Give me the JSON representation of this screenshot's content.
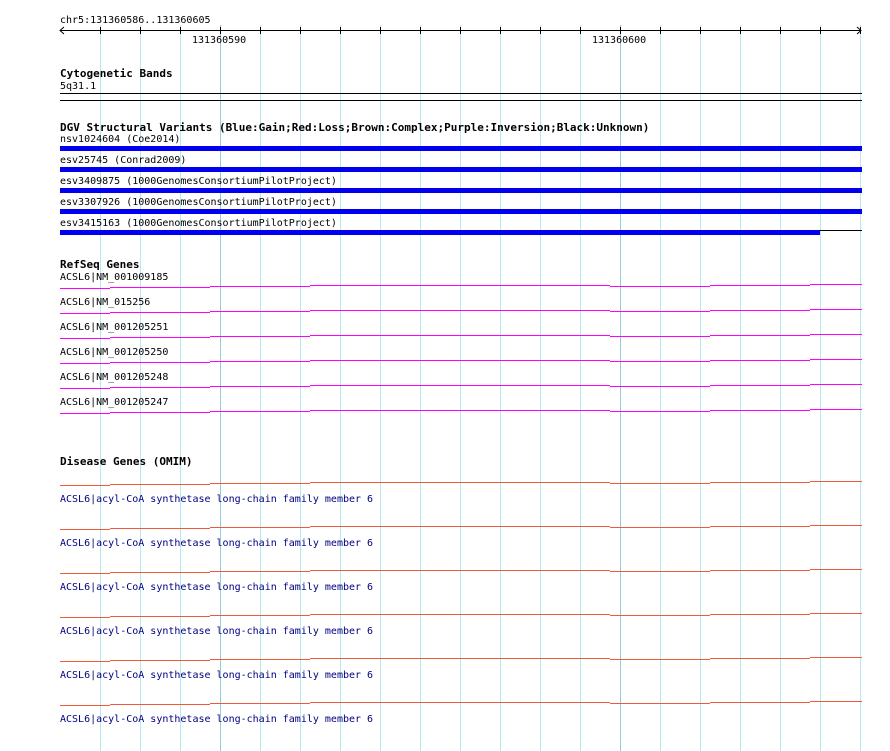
{
  "ruler": {
    "location": "chr5:131360586..131360605",
    "tick_labels": [
      "131360590",
      "131360600"
    ]
  },
  "cytoband": {
    "title": "Cytogenetic Bands",
    "band": "5q31.1"
  },
  "dgv": {
    "title": "DGV Structural Variants (Blue:Gain;Red:Loss;Brown:Complex;Purple:Inversion;Black:Unknown)",
    "items": [
      "nsv1024604 (Coe2014)",
      "esv25745 (Conrad2009)",
      "esv3409875 (1000GenomesConsortiumPilotProject)",
      "esv3307926 (1000GenomesConsortiumPilotProject)",
      "esv3415163 (1000GenomesConsortiumPilotProject)"
    ],
    "color": "#0000ee"
  },
  "refseq": {
    "title": "RefSeq Genes",
    "items": [
      "ACSL6|NM_001009185",
      "ACSL6|NM_015256",
      "ACSL6|NM_001205251",
      "ACSL6|NM_001205250",
      "ACSL6|NM_001205248",
      "ACSL6|NM_001205247"
    ],
    "color": "#ff00ff"
  },
  "omim": {
    "title": "Disease Genes (OMIM)",
    "items": [
      "ACSL6|acyl-CoA synthetase long-chain family member 6",
      "ACSL6|acyl-CoA synthetase long-chain family member 6",
      "ACSL6|acyl-CoA synthetase long-chain family member 6",
      "ACSL6|acyl-CoA synthetase long-chain family member 6",
      "ACSL6|acyl-CoA synthetase long-chain family member 6",
      "ACSL6|acyl-CoA synthetase long-chain family member 6"
    ],
    "color": "#f05a3c"
  }
}
